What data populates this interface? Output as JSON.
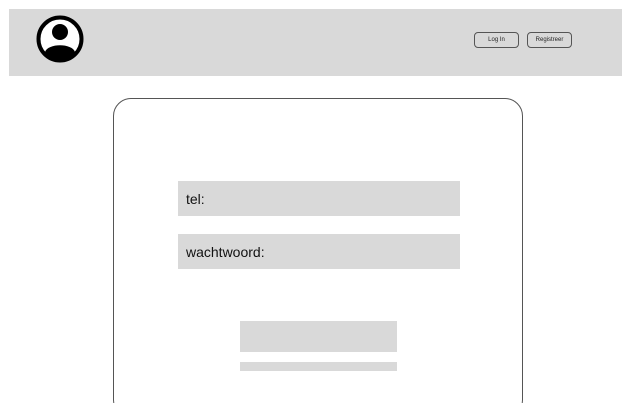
{
  "header": {
    "avatar_icon": "user-avatar-icon",
    "login_label": "Log In",
    "register_label": "Registreer"
  },
  "form": {
    "tel_label": "tel:",
    "password_label": "wachtwoord:"
  }
}
